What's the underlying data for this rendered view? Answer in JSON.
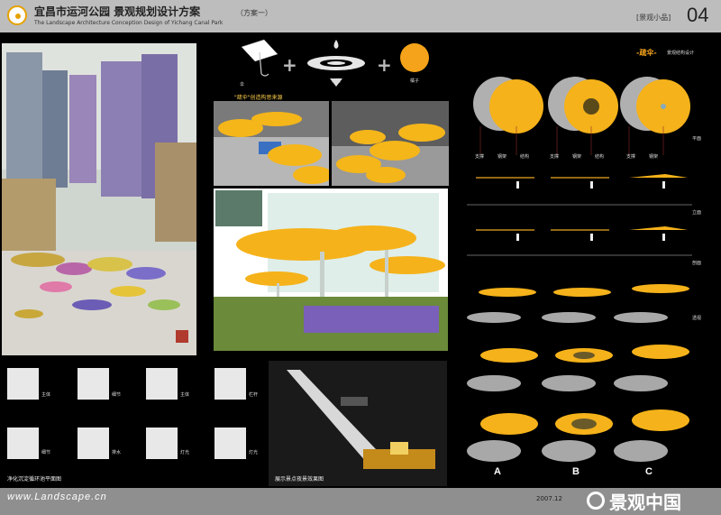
{
  "header": {
    "title_main": "宜昌市运河公园  景观规划设计方案",
    "title_sub": "The Landscape Architecture Conception Design of Yichang Canal Park",
    "scheme": "（方案一）",
    "section": "[景观小品]",
    "page_number": "04"
  },
  "concept": {
    "umbrella_label": "伞",
    "ripple_label": "雨滴",
    "orange_label": "橘子",
    "source_label": "\"疏伞\"创造构思来源",
    "right_title": "-疏伞-",
    "right_subtitle": "景观结构设计"
  },
  "left_panel": {
    "caption_1": "净化沉淀循环池平面图",
    "icons": [
      "主体",
      "细节",
      "主体",
      "栏杆",
      "细节",
      "排水",
      "灯光",
      "灯光"
    ]
  },
  "night_render": {
    "caption": "展示景点夜景效果图"
  },
  "right_panel": {
    "row_labels": [
      "平面",
      "立面",
      "剖面",
      "透视"
    ],
    "plan_notes": [
      "支撑",
      "钢架",
      "结构",
      "支撑",
      "钢架",
      "结构",
      "支撑",
      "钢架"
    ],
    "column_letters": [
      "A",
      "B",
      "C"
    ]
  },
  "footer": {
    "site": "www.Landscape.cn",
    "date": "2007.12",
    "watermark": "景观中国"
  },
  "colors": {
    "header_bg": "#bdbdbd",
    "footer_bg": "#8f8f8f",
    "accent": "#f5a31a"
  }
}
